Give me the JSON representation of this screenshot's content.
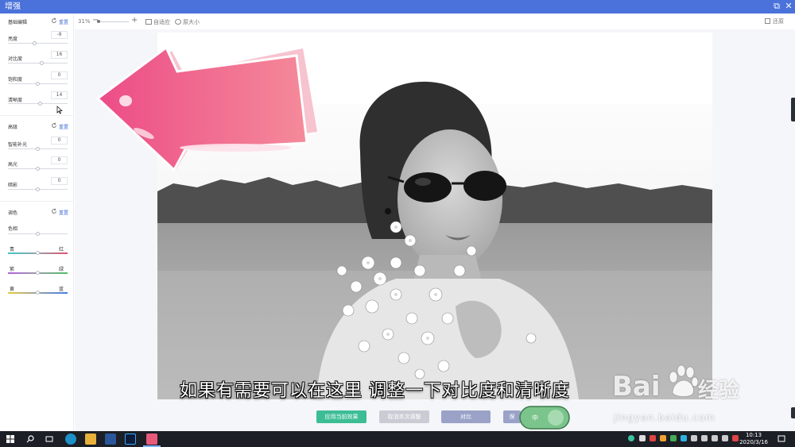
{
  "window": {
    "title": "增强",
    "restore_btn": "⧉",
    "close_btn": "✕"
  },
  "panel": {
    "basic": {
      "title": "基础编辑",
      "reset": "重置",
      "items": [
        {
          "label": "亮度",
          "value": "-9"
        },
        {
          "label": "对比度",
          "value": "16"
        },
        {
          "label": "饱和度",
          "value": "0"
        },
        {
          "label": "清晰度",
          "value": "14"
        }
      ]
    },
    "advanced": {
      "title": "高级",
      "reset": "重置",
      "items": [
        {
          "label": "智能补光",
          "value": "0"
        },
        {
          "label": "高光",
          "value": "0"
        },
        {
          "label": "暗影",
          "value": "0"
        }
      ]
    },
    "color": {
      "title": "调色",
      "reset": "重置",
      "hue_label": "色相",
      "pairs": [
        {
          "left": "青",
          "right": "红"
        },
        {
          "left": "紫",
          "right": "绿"
        },
        {
          "left": "黄",
          "right": "蓝"
        }
      ]
    }
  },
  "toolbar": {
    "zoom": "31%",
    "minus": "−",
    "plus": "+",
    "fit": "自适应",
    "original": "原大小",
    "restore": "还原"
  },
  "canvas": {
    "subtitle": "如果有需要可以在这里 调整一下对比度和清晰度"
  },
  "actions": {
    "apply_current": "应用当前效果",
    "cancel_adjust": "取消本次调整",
    "compare": "对比",
    "save": "保"
  },
  "watermark": {
    "brand": "Bai",
    "jingyan": "经验",
    "url": "jingyan.baidu.com"
  },
  "taskbar": {
    "time": "10:13",
    "date": "2020/3/16"
  },
  "colors": {
    "accent": "#4a72da",
    "apply": "#3dbd94",
    "cancel": "#c9ccd4",
    "compare": "#9aa2c8",
    "arrow": "#ef5b8c"
  }
}
